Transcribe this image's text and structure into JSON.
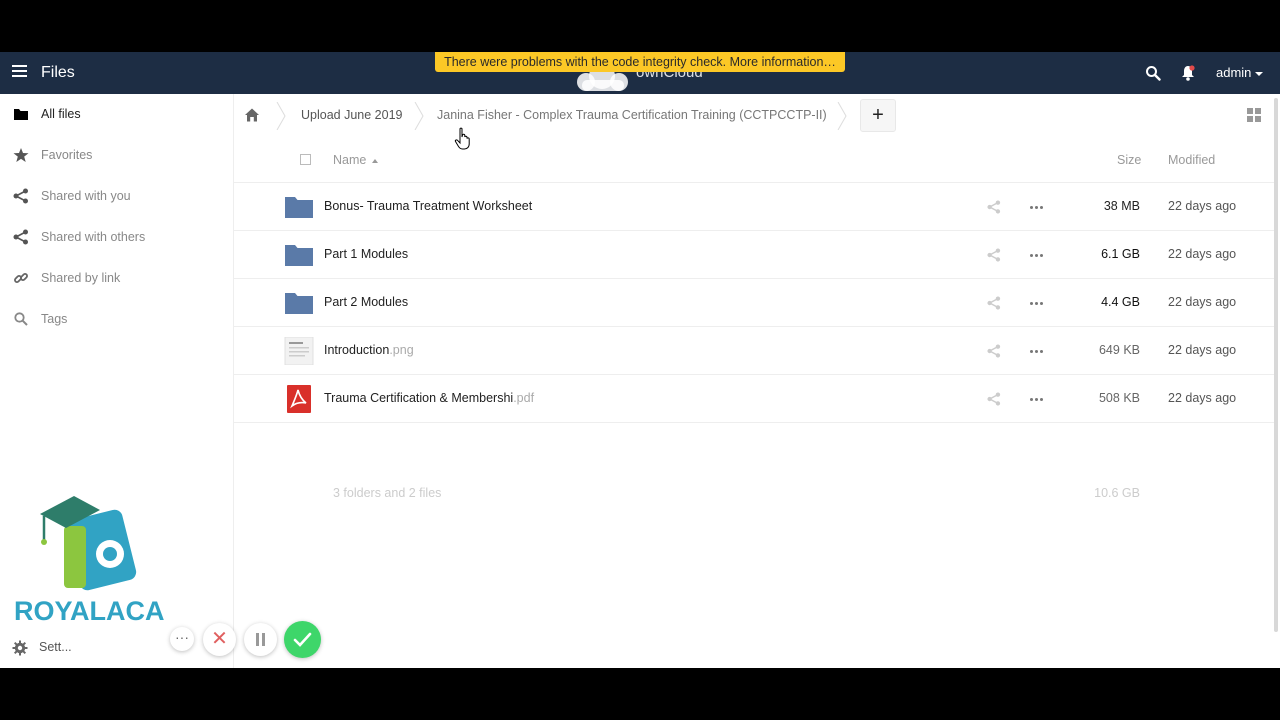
{
  "header": {
    "app_title": "Files",
    "brand": "ownCloud",
    "warning": "There were problems with the code integrity check. More information…",
    "user": "admin",
    "colors": {
      "bar": "#1d2d44",
      "warning": "#fcc826"
    }
  },
  "sidebar": {
    "items": [
      {
        "label": "All files",
        "icon": "folder-icon",
        "active": true
      },
      {
        "label": "Favorites",
        "icon": "star-icon"
      },
      {
        "label": "Shared with you",
        "icon": "share-icon"
      },
      {
        "label": "Shared with others",
        "icon": "share-icon"
      },
      {
        "label": "Shared by link",
        "icon": "link-icon"
      },
      {
        "label": "Tags",
        "icon": "search-icon"
      }
    ],
    "watermark": "ROYALACA",
    "settings_label": "Sett..."
  },
  "breadcrumb": {
    "items": [
      "Upload June 2019",
      "Janina Fisher - Complex Trauma Certification Training (CCTPCCTP-II)"
    ],
    "new_label": "+"
  },
  "list": {
    "columns": {
      "name": "Name",
      "size": "Size",
      "modified": "Modified"
    },
    "rows": [
      {
        "name": "Bonus- Trauma Treatment Worksheet",
        "ext": "",
        "type": "folder",
        "size": "38 MB",
        "modified": "22 days ago"
      },
      {
        "name": "Part 1 Modules",
        "ext": "",
        "type": "folder",
        "size": "6.1 GB",
        "modified": "22 days ago"
      },
      {
        "name": "Part 2 Modules",
        "ext": "",
        "type": "folder",
        "size": "4.4 GB",
        "modified": "22 days ago"
      },
      {
        "name": "Introduction",
        "ext": ".png",
        "type": "image",
        "size": "649 KB",
        "modified": "22 days ago"
      },
      {
        "name": "Trauma Certification & Membershi",
        "ext": ".pdf",
        "type": "pdf",
        "size": "508 KB",
        "modified": "22 days ago"
      }
    ],
    "summary": "3 folders and 2 files",
    "total_size": "10.6 GB"
  },
  "controls": {
    "more": "···",
    "close": "✕"
  }
}
